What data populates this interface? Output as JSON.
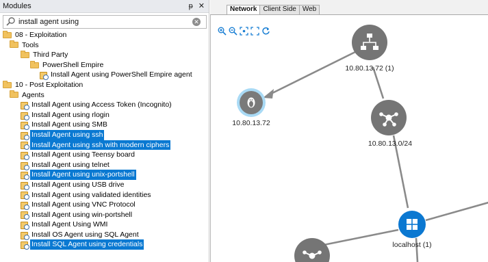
{
  "modules_panel": {
    "title": "Modules",
    "pin_glyph": "ᵽ",
    "close_glyph": "✕",
    "search": {
      "value": "install agent using",
      "clear_glyph": "✕"
    },
    "tree": [
      {
        "label": "08 - Exploitation",
        "type": "folder",
        "level": 0,
        "selected": false
      },
      {
        "label": "Tools",
        "type": "folder",
        "level": 1,
        "selected": false
      },
      {
        "label": "Third Party",
        "type": "folder",
        "level": 2,
        "selected": false
      },
      {
        "label": "PowerShell Empire",
        "type": "folder",
        "level": 3,
        "selected": false
      },
      {
        "label": "Install Agent using PowerShell Empire agent",
        "type": "module",
        "level": 4,
        "selected": false
      },
      {
        "label": "10 - Post Exploitation",
        "type": "folder",
        "level": 0,
        "selected": false
      },
      {
        "label": "Agents",
        "type": "folder",
        "level": 1,
        "selected": false
      },
      {
        "label": "Install Agent using Access Token (Incognito)",
        "type": "module",
        "level": 2,
        "selected": false
      },
      {
        "label": "Install Agent using rlogin",
        "type": "module",
        "level": 2,
        "selected": false
      },
      {
        "label": "Install Agent using SMB",
        "type": "module",
        "level": 2,
        "selected": false
      },
      {
        "label": "Install Agent using ssh",
        "type": "module",
        "level": 2,
        "selected": true
      },
      {
        "label": "Install Agent using ssh with modern ciphers",
        "type": "module",
        "level": 2,
        "selected": true
      },
      {
        "label": "Install Agent using Teensy board",
        "type": "module",
        "level": 2,
        "selected": false
      },
      {
        "label": "Install Agent using telnet",
        "type": "module",
        "level": 2,
        "selected": false
      },
      {
        "label": "Install Agent using unix-portshell",
        "type": "module",
        "level": 2,
        "selected": true
      },
      {
        "label": "Install Agent using USB drive",
        "type": "module",
        "level": 2,
        "selected": false
      },
      {
        "label": "Install Agent using validated identities",
        "type": "module",
        "level": 2,
        "selected": false
      },
      {
        "label": "Install Agent using VNC Protocol",
        "type": "module",
        "level": 2,
        "selected": false
      },
      {
        "label": "Install Agent using win-portshell",
        "type": "module",
        "level": 2,
        "selected": false
      },
      {
        "label": "Install Agent Using WMI",
        "type": "module",
        "level": 2,
        "selected": false
      },
      {
        "label": "Install OS Agent using SQL Agent",
        "type": "module",
        "level": 2,
        "selected": false
      },
      {
        "label": "Install SQL Agent using credentials",
        "type": "module",
        "level": 2,
        "selected": true
      }
    ]
  },
  "view_tabs": [
    {
      "label": "Network",
      "active": true
    },
    {
      "label": "Client Side",
      "active": false
    },
    {
      "label": "Web",
      "active": false
    }
  ],
  "zoom_toolbar": [
    "zoom-in-icon",
    "zoom-out-icon",
    "zoom-fit-icon",
    "fullscreen-icon",
    "refresh-icon"
  ],
  "network": {
    "nodes": [
      {
        "id": "router",
        "label": "10.80.13.72 (1)",
        "icon": "network-switch-icon",
        "color": "#757575"
      },
      {
        "id": "linux",
        "label": "10.80.13.72",
        "icon": "linux-penguin-icon",
        "color": "#7a7a7a",
        "ring": "#7fc8f0"
      },
      {
        "id": "subnet1",
        "label": "10.80.13.0/24",
        "icon": "network-hub-icon",
        "color": "#757575"
      },
      {
        "id": "localhost",
        "label": "localhost (1)",
        "icon": "windows-icon",
        "color": "#0b78d1"
      },
      {
        "id": "subnet2",
        "label": "",
        "icon": "network-hub-icon",
        "color": "#757575"
      }
    ],
    "edge_color": "#8a8a8a",
    "selection_color": "#0a79d2"
  }
}
